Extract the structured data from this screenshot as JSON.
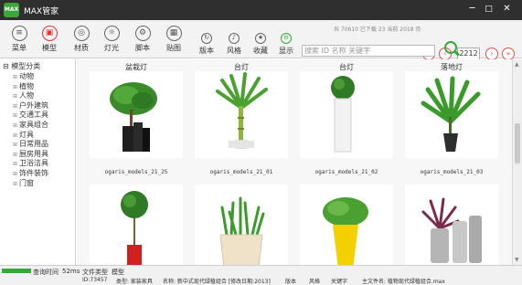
{
  "app": {
    "logo_text": "MAX",
    "title": "MAX管家"
  },
  "window": {
    "minimize": "─",
    "maximize": "□",
    "close": "✕"
  },
  "toolbar": {
    "items": [
      {
        "label": "菜单",
        "icon": "menu-icon",
        "glyph": "≡"
      },
      {
        "label": "模型",
        "icon": "model-icon",
        "glyph": "▣"
      },
      {
        "label": "材质",
        "icon": "material-icon",
        "glyph": "◎"
      },
      {
        "label": "灯光",
        "icon": "light-icon",
        "glyph": "☼"
      },
      {
        "label": "脚本",
        "icon": "script-icon",
        "glyph": "⚙"
      },
      {
        "label": "贴图",
        "icon": "map-icon",
        "glyph": "▦"
      }
    ],
    "small_items": [
      {
        "label": "版本",
        "icon": "version-icon",
        "glyph": "↻"
      },
      {
        "label": "风格",
        "icon": "style-icon",
        "glyph": "♪"
      },
      {
        "label": "收藏",
        "icon": "favorite-icon",
        "glyph": "★"
      },
      {
        "label": "显示",
        "icon": "display-icon",
        "glyph": "⊖"
      }
    ]
  },
  "stats": "共 70610   已下载 23   当前 2018 页",
  "search": {
    "placeholder": "搜索   ID   名称   关键字"
  },
  "pager": {
    "first": "«",
    "prev": "‹",
    "page": "2212",
    "next": "›",
    "last": "»"
  },
  "sidebar": {
    "root": "⊟ 模型分类",
    "items": [
      "动物",
      "植物",
      "人物",
      "户外建筑",
      "交通工具",
      "家具组合",
      "灯具",
      "日常用品",
      "厨房用具",
      "卫浴洁具",
      "饰件装饰",
      "门窗"
    ]
  },
  "cards": [
    {
      "title": "盆栽灯",
      "name": "ogaris_models_21_25",
      "plant": "tree-round",
      "pot": "#222"
    },
    {
      "title": "台灯",
      "name": "ogaris_models_21_01",
      "plant": "bamboo",
      "pot": "#e8e8e8"
    },
    {
      "title": "台灯",
      "name": "ogaris_models_21_02",
      "plant": "ball",
      "pot": "#eeeeee"
    },
    {
      "title": "落地灯",
      "name": "ogaris_models_21_03",
      "plant": "palm",
      "pot": "#333"
    },
    {
      "title": "",
      "name": "",
      "plant": "topiary",
      "pot": "#d22"
    },
    {
      "title": "",
      "name": "",
      "plant": "grass",
      "pot": "#efe2c8"
    },
    {
      "title": "",
      "name": "",
      "plant": "fern",
      "pot": "#f4d000"
    },
    {
      "title": "",
      "name": "",
      "plant": "spiky",
      "pot": "#bbbbbb"
    }
  ],
  "status": {
    "time_label": "查询时间",
    "time_value": "52ms",
    "type_label": "文件类型",
    "type_value": "模型",
    "id": "ID:73457",
    "category": "类型: 家装家具",
    "name": "名称: 新中式现代绿植组合 [修改日期:2013]",
    "version": "版本",
    "style": "风格",
    "keywords": "关键字",
    "file": "主文件名: 植物现代绿植组合.max"
  },
  "scrollbar": {
    "up": "▲",
    "down": "▼"
  }
}
